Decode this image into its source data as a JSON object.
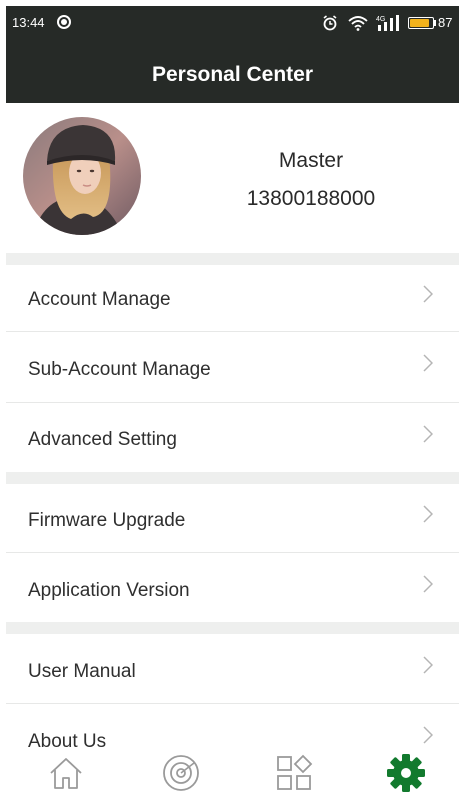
{
  "status_bar": {
    "time": "13:44",
    "battery_percent": "87",
    "battery_level": 0.87,
    "icons": [
      "dnd-icon",
      "alarm-icon",
      "wifi-icon",
      "signal-icon",
      "battery-icon"
    ]
  },
  "header": {
    "title": "Personal Center",
    "background": "#262a27"
  },
  "profile": {
    "name": "Master",
    "phone": "13800188000"
  },
  "menu": {
    "account_manage": "Account Manage",
    "sub_account_manage": "Sub-Account Manage",
    "advanced_setting": "Advanced Setting",
    "firmware_upgrade": "Firmware Upgrade",
    "application_version": "Application Version",
    "user_manual": "User Manual",
    "about_us": "About Us"
  },
  "tab_bar": {
    "tabs": [
      "home-icon",
      "monitor-icon",
      "apps-icon",
      "settings-icon"
    ],
    "active": "settings-icon",
    "active_color": "#127a2e",
    "inactive_color": "#9a9a9a"
  },
  "colors": {
    "section_gap": "#eeefee",
    "text": "#2f2f2f",
    "chevron": "#b5b5b5"
  }
}
